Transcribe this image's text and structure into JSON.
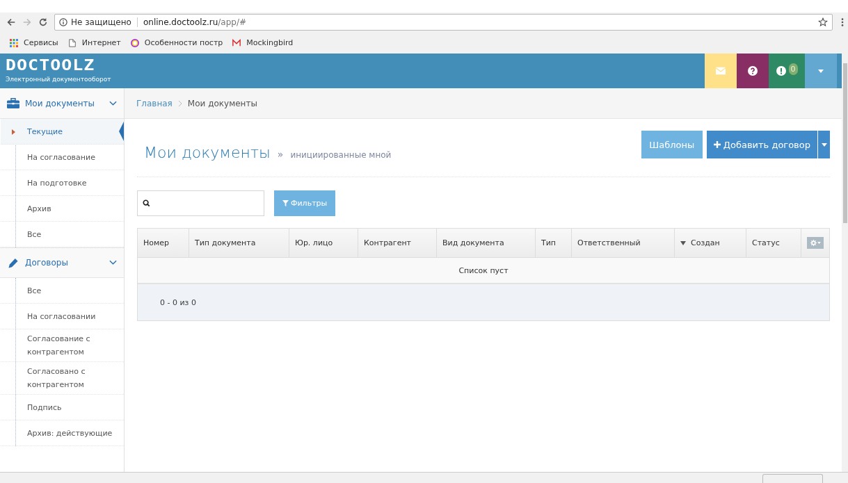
{
  "browser": {
    "security": "Не защищено",
    "url_host": "online.doctoolz.ru",
    "url_path": "/app/#",
    "bookmarks": [
      {
        "kind": "apps",
        "label": "Сервисы"
      },
      {
        "kind": "page",
        "label": "Интернет"
      },
      {
        "kind": "site",
        "label": "Особенности постр"
      },
      {
        "kind": "mail",
        "label": "Mockingbird"
      }
    ]
  },
  "app_header": {
    "logo": "DOCTOOLZ",
    "tagline": "Электронный документооборот",
    "buttons": [
      {
        "kind": "mail"
      },
      {
        "kind": "help"
      },
      {
        "kind": "alerts",
        "badge": "0"
      },
      {
        "kind": "user"
      }
    ]
  },
  "sidebar": {
    "sections": [
      {
        "kind": "briefcase",
        "label": "Мои документы",
        "expanded": true,
        "items": [
          {
            "label": "Текущие",
            "selected": true
          },
          {
            "label": "На согласование",
            "selected": false
          },
          {
            "label": "На подготовке",
            "selected": false
          },
          {
            "label": "Архив",
            "selected": false
          },
          {
            "label": "Все",
            "selected": false
          }
        ]
      },
      {
        "kind": "pencil",
        "label": "Договоры",
        "expanded": true,
        "items": [
          {
            "label": "Все",
            "selected": false
          },
          {
            "label": "На согласовании",
            "selected": false
          },
          {
            "label": "Согласование с контрагентом",
            "selected": false
          },
          {
            "label": "Согласовано с контрагентом",
            "selected": false
          },
          {
            "label": "Подпись",
            "selected": false
          },
          {
            "label": "Архив: действующие",
            "selected": false
          }
        ]
      }
    ]
  },
  "breadcrumbs": [
    {
      "label": "Главная"
    },
    {
      "label": "Мои документы"
    }
  ],
  "page": {
    "title": "Мои документы",
    "separator": "»",
    "subtitle": "инициированные мной",
    "buttons": [
      {
        "kind": "secondary",
        "label": "Шаблоны"
      },
      {
        "kind": "primary",
        "label": "Добавить договор"
      }
    ]
  },
  "filter_button": {
    "label": "Фильтры"
  },
  "table": {
    "columns": [
      {
        "label": "Номер",
        "sorted": false
      },
      {
        "label": "Тип документа",
        "sorted": false
      },
      {
        "label": "Юр. лицо",
        "sorted": false
      },
      {
        "label": "Контрагент",
        "sorted": false
      },
      {
        "label": "Вид документа",
        "sorted": false
      },
      {
        "label": "Тип",
        "sorted": false
      },
      {
        "label": "Ответственный",
        "sorted": false
      },
      {
        "label": "Создан",
        "sorted": true
      },
      {
        "label": "Статус",
        "sorted": false
      }
    ],
    "empty_message": "Список пуст",
    "pagination": "0 - 0 из 0"
  }
}
